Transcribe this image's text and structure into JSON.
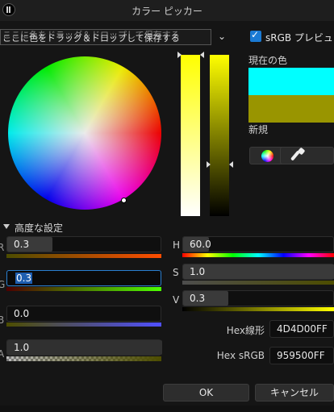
{
  "window": {
    "title": "カラー ピッカー"
  },
  "theme_bar": {
    "text": "ここに色をドラッグ＆ドロップして保存する",
    "ghost_text": "ここに色をドラッグ＆ドロップして保存する"
  },
  "srgb_preview": {
    "label": "sRGB プレビュー",
    "checked": true
  },
  "swatches": {
    "current_label": "現在の色",
    "new_label": "新規",
    "current_color": "#00FFFF",
    "new_color": "#999500"
  },
  "advanced": {
    "label": "高度な設定",
    "expanded": true
  },
  "channels": {
    "R": {
      "letter": "R",
      "value": "0.3"
    },
    "G": {
      "letter": "G",
      "value": "0.3"
    },
    "B": {
      "letter": "B",
      "value": "0.0"
    },
    "A": {
      "letter": "A",
      "value": "1.0"
    },
    "H": {
      "letter": "H",
      "value": "60.0"
    },
    "S": {
      "letter": "S",
      "value": "1.0"
    },
    "V": {
      "letter": "V",
      "value": "0.3"
    }
  },
  "hex": {
    "linear_label": "Hex線形",
    "linear_value": "4D4D00FF",
    "srgb_label": "Hex sRGB",
    "srgb_value": "959500FF"
  },
  "buttons": {
    "ok": "OK",
    "cancel": "キャンセル"
  },
  "icons": {
    "wheel": "color-wheel-icon",
    "dropper": "eyedropper-icon"
  }
}
